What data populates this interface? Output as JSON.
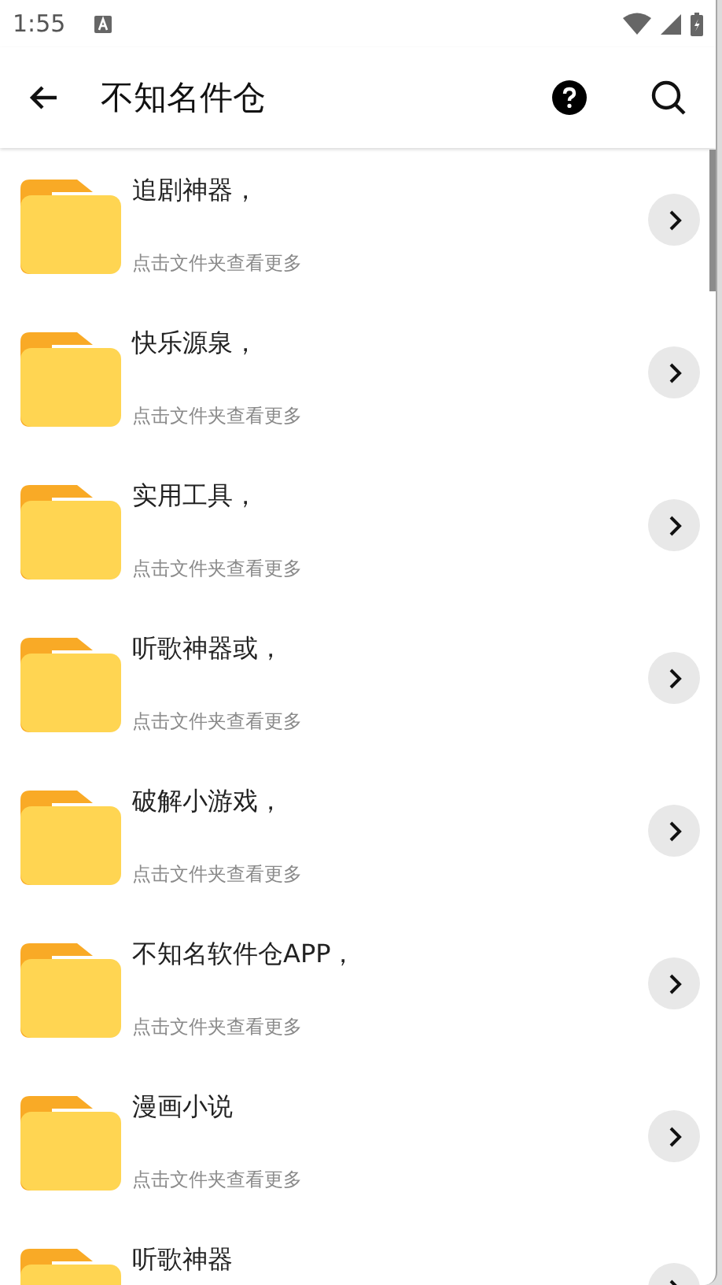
{
  "status_bar": {
    "time": "1:55"
  },
  "app_bar": {
    "title": "不知名件仓"
  },
  "folders": [
    {
      "title": "追剧神器，",
      "subtitle": "点击文件夹查看更多"
    },
    {
      "title": "快乐源泉，",
      "subtitle": "点击文件夹查看更多"
    },
    {
      "title": "实用工具，",
      "subtitle": "点击文件夹查看更多"
    },
    {
      "title": "听歌神器或，",
      "subtitle": "点击文件夹查看更多"
    },
    {
      "title": "破解小游戏，",
      "subtitle": "点击文件夹查看更多"
    },
    {
      "title": "不知名软件仓APP，",
      "subtitle": "点击文件夹查看更多"
    },
    {
      "title": "漫画小说",
      "subtitle": "点击文件夹查看更多"
    },
    {
      "title": "听歌神器"
    }
  ]
}
